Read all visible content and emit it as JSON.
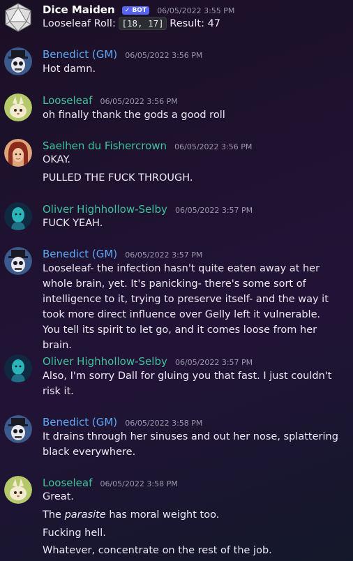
{
  "messages": [
    {
      "author": "Dice Maiden",
      "bot_badge": "✓ BOT",
      "time": "06/05/2022 3:55 PM",
      "roll_label": "Looseleaf Roll:",
      "roll_code": "[18, 17]",
      "result": "Result: 47"
    },
    {
      "author": "Benedict (GM)",
      "time": "06/05/2022 3:56 PM",
      "lines": [
        "Hot damn."
      ]
    },
    {
      "author": "Looseleaf",
      "time": "06/05/2022 3:56 PM",
      "lines": [
        "oh finally thank the gods a good roll"
      ]
    },
    {
      "author": "Saelhen du Fishercrown",
      "time": "06/05/2022 3:56 PM",
      "lines": [
        "OKAY.",
        "PULLED THE FUCK THROUGH."
      ]
    },
    {
      "author": "Oliver Highhollow-Selby",
      "time": "06/05/2022 3:57 PM",
      "lines": [
        "FUCK YEAH."
      ]
    },
    {
      "author": "Benedict (GM)",
      "time": "06/05/2022 3:57 PM",
      "text": "Looseleaf- the infection hasn't quite eaten away at her whole brain, yet. It's panicking- there's some sort of intelligence to it, trying to preserve itself- and the way it took more direct influence over Gelly left it vulnerable. You tell its spirit to let go, and it comes loose from her brain."
    },
    {
      "author": "Oliver Highhollow-Selby",
      "time": "06/05/2022 3:57 PM",
      "text": "Also, I'm sorry Dall for gluing you that fast. I just couldn't risk it."
    },
    {
      "author": "Benedict (GM)",
      "time": "06/05/2022 3:58 PM",
      "text": "It drains through her sinuses and out her nose, splattering black everywhere."
    },
    {
      "author": "Looseleaf",
      "time": "06/05/2022 3:58 PM",
      "lines": [
        "Great.",
        "Fucking hell.",
        "Whatever, concentrate on the rest of the job."
      ],
      "parasite_pre": "The ",
      "parasite_word": "parasite",
      "parasite_post": " has moral weight too."
    }
  ],
  "colors": {
    "dice_maiden": "#ffffff",
    "benedict": "#5ea8f5",
    "looseleaf": "#3fc29a",
    "saelhen": "#3fc29a",
    "oliver": "#3fc29a",
    "bot_badge": "#5865f2"
  },
  "icons": {
    "dice_maiden": "d20-die-avatar",
    "benedict": "skull-top-hat-avatar",
    "looseleaf": "cream-creature-avatar",
    "saelhen": "red-haired-person-avatar",
    "oliver": "teal-figure-avatar"
  }
}
